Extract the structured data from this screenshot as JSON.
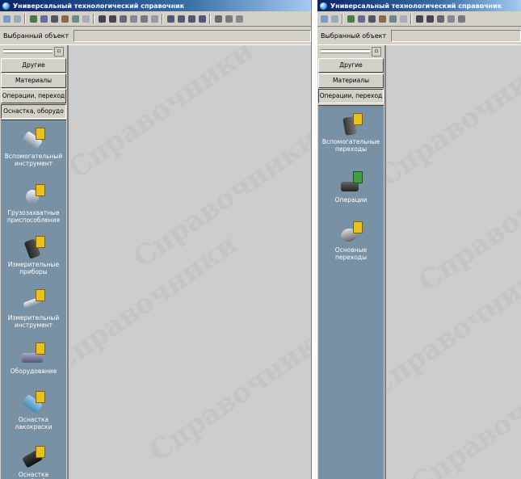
{
  "window": {
    "title": "Универсальный технологический справочник",
    "selected_label": "Выбранный объект",
    "watermark": "Справочники"
  },
  "left_window": {
    "categories": [
      "Другие",
      "Материалы",
      "Операции, переход",
      "Оснастка, оборудо"
    ],
    "active_category": "Оснастка, оборудо",
    "items": [
      {
        "label": "Вспомогательный инструмент",
        "icon": "tool-icon"
      },
      {
        "label": "Грузозахватные приспособления",
        "icon": "hook-icon"
      },
      {
        "label": "Измерительные приборы",
        "icon": "microscope-icon"
      },
      {
        "label": "Измерительный инструмент",
        "icon": "caliper-icon"
      },
      {
        "label": "Оборудование",
        "icon": "machine-icon"
      },
      {
        "label": "Оснастка лакокраски",
        "icon": "paint-icon"
      },
      {
        "label": "Оснастка термообработки",
        "icon": "heat-treatment-icon"
      }
    ]
  },
  "right_window": {
    "categories": [
      "Другие",
      "Материалы",
      "Операции, переход"
    ],
    "active_category": "Операции, переход",
    "items": [
      {
        "label": "Вспомогательные переходы",
        "icon": "auxiliary-transition-icon"
      },
      {
        "label": "Операции",
        "icon": "anvil-icon"
      },
      {
        "label": "Основные переходы",
        "icon": "main-transition-icon"
      }
    ]
  },
  "colors": {
    "titlebar": "#0a246a",
    "panel_bg": "#7991a5",
    "workspace": "#cccccc",
    "chrome": "#d4d0c8"
  }
}
